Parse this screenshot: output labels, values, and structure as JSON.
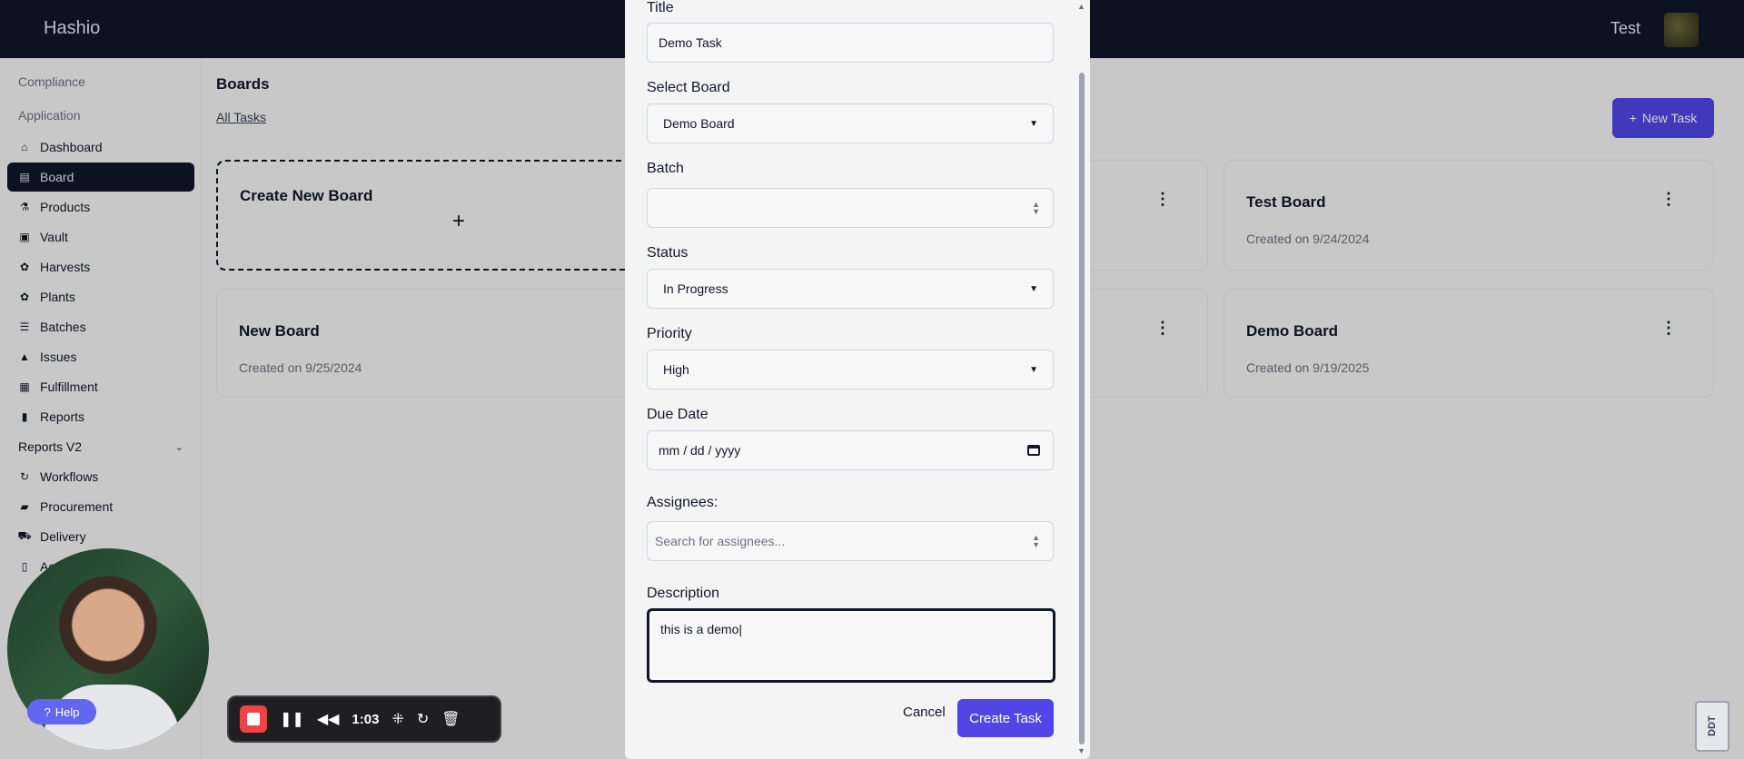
{
  "app": {
    "brand": "Hashio",
    "user_name": "Test"
  },
  "sidebar": {
    "sections": [
      "Compliance",
      "Application"
    ],
    "items": [
      {
        "label": "Dashboard",
        "icon": "home-icon"
      },
      {
        "label": "Board",
        "icon": "board-icon",
        "active": true
      },
      {
        "label": "Products",
        "icon": "products-icon"
      },
      {
        "label": "Vault",
        "icon": "vault-icon"
      },
      {
        "label": "Harvests",
        "icon": "harvest-icon"
      },
      {
        "label": "Plants",
        "icon": "plant-icon"
      },
      {
        "label": "Batches",
        "icon": "batches-icon"
      },
      {
        "label": "Issues",
        "icon": "warning-icon"
      },
      {
        "label": "Fulfillment",
        "icon": "fulfillment-icon"
      },
      {
        "label": "Reports",
        "icon": "bar-chart-icon"
      },
      {
        "label": "Reports V2",
        "icon": "chevron-down-icon"
      },
      {
        "label": "Workflows",
        "icon": "workflow-icon"
      },
      {
        "label": "Procurement",
        "icon": "bag-icon"
      },
      {
        "label": "Delivery",
        "icon": "truck-icon"
      },
      {
        "label": "Acti",
        "icon": "document-icon"
      }
    ]
  },
  "main": {
    "title": "Boards",
    "all_tasks": "All Tasks",
    "new_task": "New Task",
    "create_board": "Create New Board",
    "create_plus": "+",
    "boards": [
      {
        "name": "Test Board",
        "date": "Created on 9/24/2024"
      },
      {
        "name": "New Board",
        "date": "Created on 9/25/2024"
      },
      {
        "name": "Demo Board",
        "date": "Created on 9/19/2025"
      }
    ]
  },
  "modal": {
    "title_label": "Title",
    "title_value": "Demo Task",
    "board_label": "Select Board",
    "board_value": "Demo Board",
    "batch_label": "Batch",
    "batch_value": "",
    "status_label": "Status",
    "status_value": "In Progress",
    "priority_label": "Priority",
    "priority_value": "High",
    "due_label": "Due Date",
    "due_placeholder": "mm / dd / yyyy",
    "assignees_label": "Assignees:",
    "assignees_placeholder": "Search for assignees...",
    "description_label": "Description",
    "description_value": "this is a demo",
    "cancel": "Cancel",
    "create": "Create Task"
  },
  "overlays": {
    "help": "Help",
    "recording_time": "1:03",
    "corner_logo": "DDT"
  },
  "colors": {
    "accent": "#4f46e5",
    "topbar": "#0f172a",
    "record": "#ef4444"
  }
}
